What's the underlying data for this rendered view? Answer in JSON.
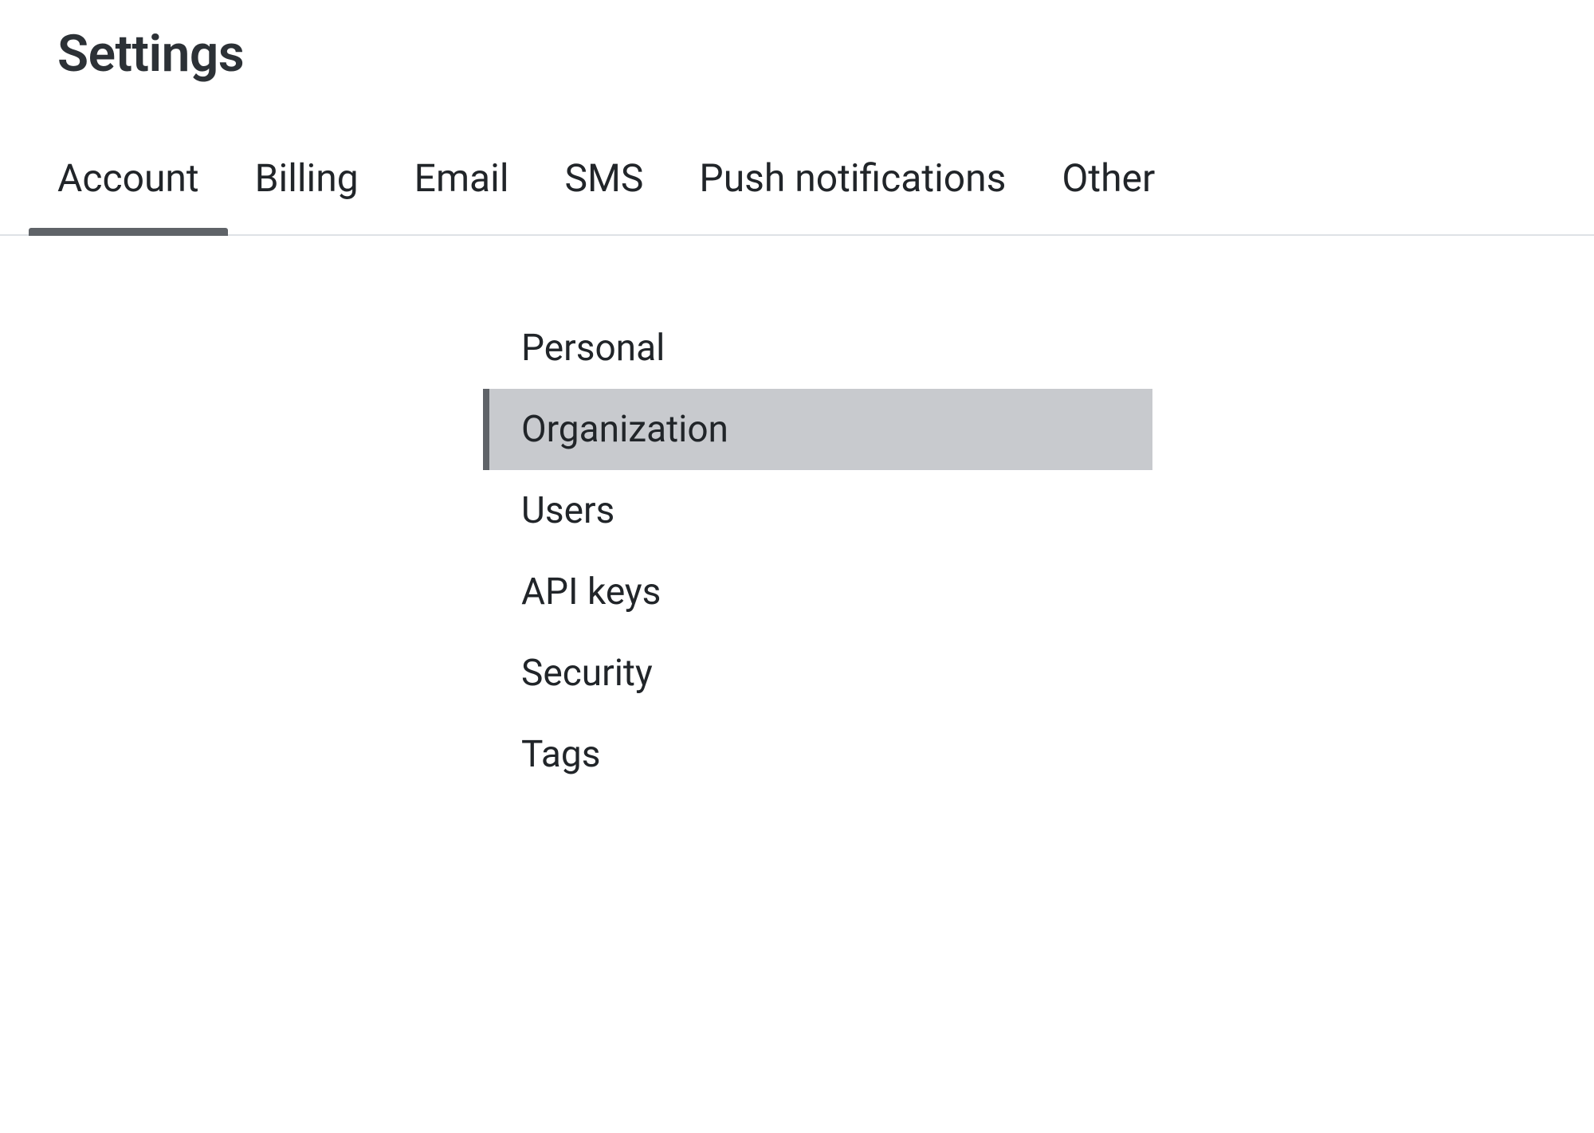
{
  "header": {
    "title": "Settings"
  },
  "tabs": [
    {
      "label": "Account",
      "active": true
    },
    {
      "label": "Billing",
      "active": false
    },
    {
      "label": "Email",
      "active": false
    },
    {
      "label": "SMS",
      "active": false
    },
    {
      "label": "Push notifications",
      "active": false
    },
    {
      "label": "Other",
      "active": false
    }
  ],
  "sidenav": {
    "items": [
      {
        "label": "Personal",
        "selected": false
      },
      {
        "label": "Organization",
        "selected": true
      },
      {
        "label": "Users",
        "selected": false
      },
      {
        "label": "API keys",
        "selected": false
      },
      {
        "label": "Security",
        "selected": false
      },
      {
        "label": "Tags",
        "selected": false
      }
    ]
  }
}
